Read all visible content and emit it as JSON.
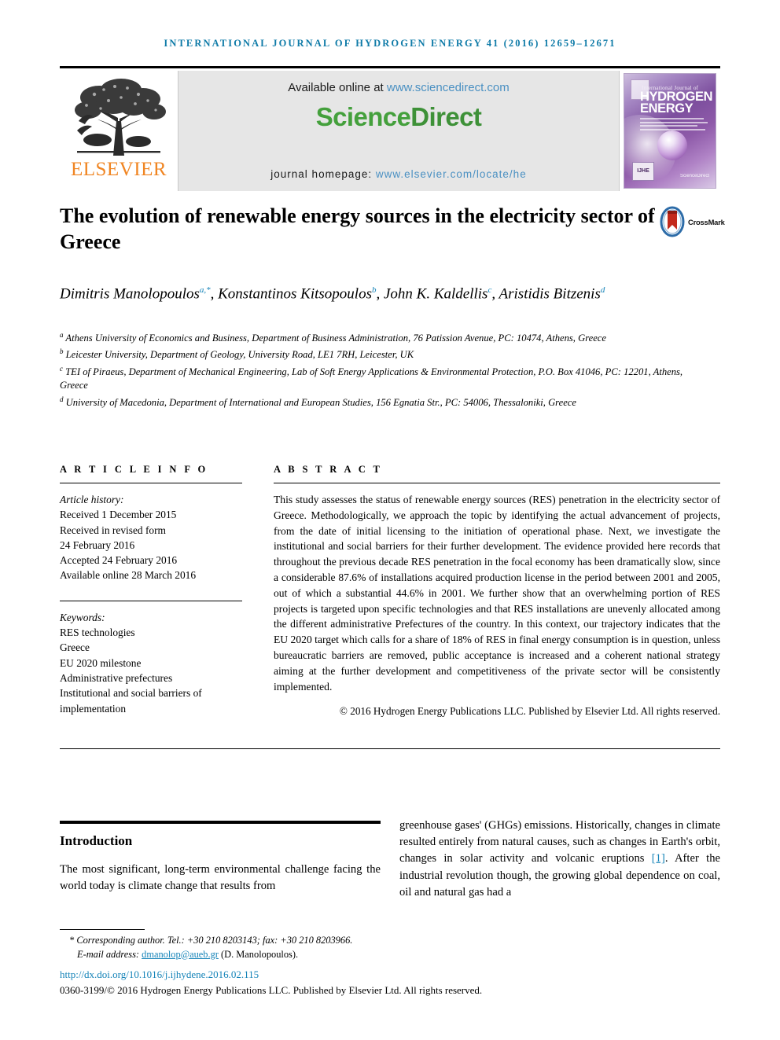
{
  "running_head": "International Journal of Hydrogen Energy 41 (2016) 12659–12671",
  "masthead": {
    "publisher_name": "ELSEVIER",
    "publisher_logo_name": "elsevier-tree-logo",
    "available_prefix": "Available online at ",
    "sciencedirect_url": "www.sciencedirect.com",
    "sciencedirect_logo_part1": "Science",
    "sciencedirect_logo_part2": "Direct",
    "homepage_prefix": "journal homepage: ",
    "homepage_url": "www.elsevier.com/locate/he",
    "cover": {
      "line_small": "International Journal of",
      "line_big_1": "HYDROGEN",
      "line_big_2": "ENERGY",
      "badge": "IJHE",
      "sd_note": "ScienceDirect"
    }
  },
  "article": {
    "title": "The evolution of renewable energy sources in the electricity sector of Greece",
    "crossmark_label": "CrossMark",
    "authors": [
      {
        "name": "Dimitris Manolopoulos",
        "marks": "a,*"
      },
      {
        "name": "Konstantinos Kitsopoulos",
        "marks": "b"
      },
      {
        "name": "John K. Kaldellis",
        "marks": "c"
      },
      {
        "name": "Aristidis Bitzenis",
        "marks": "d"
      }
    ],
    "affiliations": [
      {
        "mark": "a",
        "text": "Athens University of Economics and Business, Department of Business Administration, 76 Patission Avenue, PC: 10474, Athens, Greece"
      },
      {
        "mark": "b",
        "text": "Leicester University, Department of Geology, University Road, LE1 7RH, Leicester, UK"
      },
      {
        "mark": "c",
        "text": "TEI of Piraeus, Department of Mechanical Engineering, Lab of Soft Energy Applications & Environmental Protection, P.O. Box 41046, PC: 12201, Athens, Greece"
      },
      {
        "mark": "d",
        "text": "University of Macedonia, Department of International and European Studies, 156 Egnatia Str., PC: 54006, Thessaloniki, Greece"
      }
    ]
  },
  "article_info": {
    "heading": "A R T I C L E   I N F O",
    "history_label": "Article history:",
    "history": [
      "Received 1 December 2015",
      "Received in revised form",
      "24 February 2016",
      "Accepted 24 February 2016",
      "Available online 28 March 2016"
    ],
    "keywords_label": "Keywords:",
    "keywords": [
      "RES technologies",
      "Greece",
      "EU 2020 milestone",
      "Administrative prefectures",
      "Institutional and social barriers of implementation"
    ]
  },
  "abstract": {
    "heading": "A B S T R A C T",
    "text": "This study assesses the status of renewable energy sources (RES) penetration in the electricity sector of Greece. Methodologically, we approach the topic by identifying the actual advancement of projects, from the date of initial licensing to the initiation of operational phase. Next, we investigate the institutional and social barriers for their further development. The evidence provided here records that throughout the previous decade RES penetration in the focal economy has been dramatically slow, since a considerable 87.6% of installations acquired production license in the period between 2001 and 2005, out of which a substantial 44.6% in 2001. We further show that an overwhelming portion of RES projects is targeted upon specific technologies and that RES installations are unevenly allocated among the different administrative Prefectures of the country. In this context, our trajectory indicates that the EU 2020 target which calls for a share of 18% of RES in final energy consumption is in question, unless bureaucratic barriers are removed, public acceptance is increased and a coherent national strategy aiming at the further development and competitiveness of the private sector will be consistently implemented.",
    "copyright": "© 2016 Hydrogen Energy Publications LLC. Published by Elsevier Ltd. All rights reserved."
  },
  "introduction": {
    "heading": "Introduction",
    "left_paragraph": "The most significant, long-term environmental challenge facing the world today is climate change that results from",
    "right_paragraph_part1": "greenhouse gases' (GHGs) emissions. Historically, changes in climate resulted entirely from natural causes, such as changes in Earth's orbit, changes in solar activity and volcanic eruptions ",
    "right_reference": "[1]",
    "right_paragraph_part2": ". After the industrial revolution though, the growing global dependence on coal, oil and natural gas had a"
  },
  "footer": {
    "corresponding_marker": "*",
    "corresponding_text": "Corresponding author. Tel.: +30 210 8203143; fax: +30 210 8203966.",
    "email_label": "E-mail address: ",
    "email": "dmanolop@aueb.gr",
    "email_suffix": " (D. Manolopoulos).",
    "doi": "http://dx.doi.org/10.1016/j.ijhydene.2016.02.115",
    "issn_line": "0360-3199/© 2016 Hydrogen Energy Publications LLC. Published by Elsevier Ltd. All rights reserved."
  },
  "colors": {
    "journal_blue": "#0f7ba8",
    "link_blue": "#4a90c2",
    "ref_blue": "#1483b8",
    "elsevier_orange": "#f08522",
    "sciencedirect_green": "#44a03c",
    "banner_gray": "#e6e6e6"
  }
}
